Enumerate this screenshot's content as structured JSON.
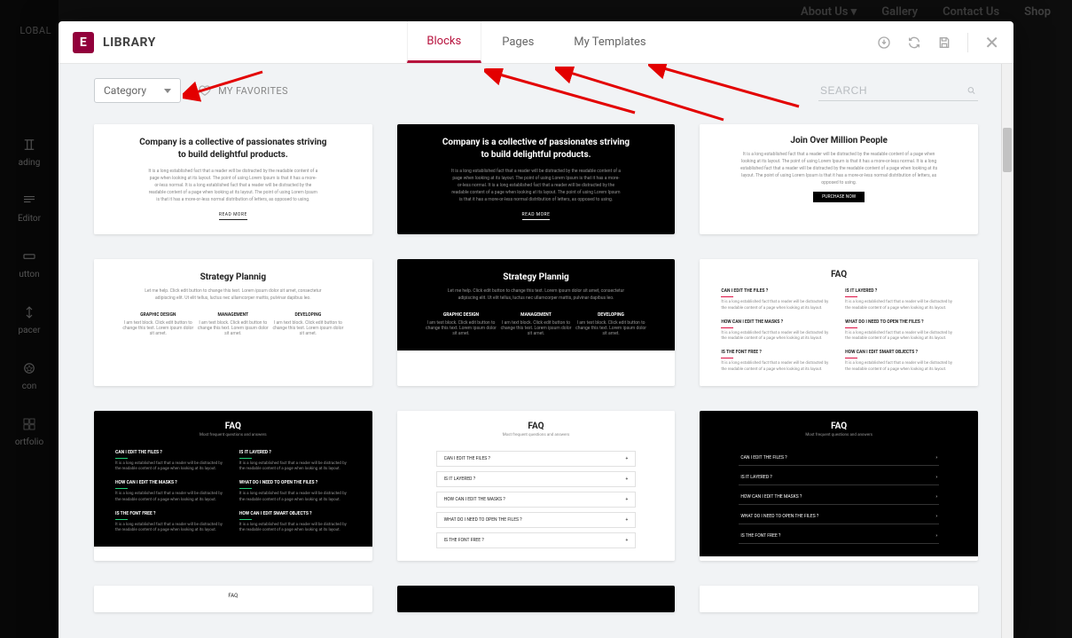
{
  "bg": {
    "nav": {
      "about": "About Us",
      "gallery": "Gallery",
      "contact": "Contact Us",
      "shop": "Shop"
    },
    "global": "LOBAL",
    "widgets": {
      "heading": "ading",
      "textEditor": "Editor",
      "button": "utton",
      "spacer": "pacer",
      "icon": "con",
      "portfolio": "ortfolio"
    }
  },
  "header": {
    "title": "LIBRARY",
    "tabs": {
      "blocks": "Blocks",
      "pages": "Pages",
      "myTemplates": "My Templates"
    },
    "activeTab": "Blocks"
  },
  "toolbar": {
    "category": "Category",
    "favorites": "MY FAVORITES",
    "searchPlaceholder": "SEARCH"
  },
  "previews": {
    "companyTitle": "Company is a collective of passionates striving to build delightful products.",
    "lorem": "It is a long established fact that a reader will be distracted by the readable content of a page when looking at its layout. The point of using Lorem Ipsum is that it has a more-or-less normal. It is a long established fact that a reader will be distracted by the readable content of a page when looking at its layout. The point of using Lorem Ipsum is that it has a more-or-less normal distribution of letters, as opposed to using.",
    "readMore": "READ MORE",
    "joinTitle": "Join Over Million People",
    "purchase": "PURCHASE NOW",
    "strategyTitle": "Strategy Plannig",
    "strategySub": "Let me help. Click edit button to change this text. Lorem ipsum dolor sit amet, consectetur adipiscing elit. Ut elit tellus, luctus nec ullamcorper mattis, pulvinar dapibus leo.",
    "cols": {
      "c1": "GRAPHIC DESIGN",
      "c2": "MANAGEMENT",
      "c3": "DEVELOPING"
    },
    "colSub": "I am text block. Click edit button to change this text. Lorem ipsum dolor sit amet.",
    "faqTitle": "FAQ",
    "faqSub": "Most frequent questions and answers",
    "q1": "CAN I EDIT THE FILES ?",
    "q2": "IS IT LAYERED ?",
    "q3": "HOW CAN I EDIT THE MASKS ?",
    "q4": "WHAT DO I NEED TO OPEN THE FILES ?",
    "q5": "IS THE FONT FREE ?",
    "q6": "HOW CAN I EDIT SMART OBJECTS ?",
    "ans": "It is a long established fact that a reader will be distracted by the readable content of a page when looking at its layout."
  }
}
